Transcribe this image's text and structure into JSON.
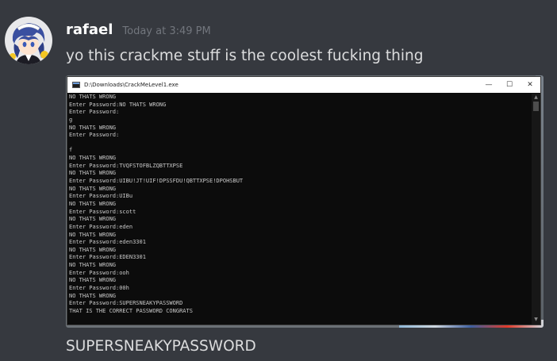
{
  "message": {
    "username": "rafael",
    "timestamp": "Today at 3:49 PM",
    "text": "yo this crackme stuff is the coolest fucking thing",
    "followup": "SUPERSNEAKYPASSWORD"
  },
  "console": {
    "title": "D:\\Downloads\\CrackMeLevel1.exe",
    "controls": {
      "minimize": "—",
      "maximize": "☐",
      "close": "✕"
    },
    "lines": [
      "NO THATS WRONG",
      "Enter Password:NO THATS WRONG",
      "Enter Password:",
      "g",
      "NO THATS WRONG",
      "Enter Password:",
      "",
      "f",
      "NO THATS WRONG",
      "Enter Password:TVQFSTOFBLZQBTTXPSE",
      "NO THATS WRONG",
      "Enter Password:UIBU!JT!UIF!DPSSFDU!QBTTXPSE!DPOHSBUT",
      "NO THATS WRONG",
      "Enter Password:UIBu",
      "NO THATS WRONG",
      "Enter Password:scott",
      "NO THATS WRONG",
      "Enter Password:eden",
      "NO THATS WRONG",
      "Enter Password:eden3301",
      "NO THATS WRONG",
      "Enter Password:EDEN3301",
      "NO THATS WRONG",
      "Enter Password:ooh",
      "NO THATS WRONG",
      "Enter Password:00h",
      "NO THATS WRONG",
      "Enter Password:SUPERSNEAKYPASSWORD",
      "THAT IS THE CORRECT PASSWORD CONGRATS",
      "",
      "_"
    ]
  },
  "icons": {
    "avatar": "anime-avatar",
    "app": "console-app-icon",
    "scroll_up": "▲",
    "scroll_down": "▼"
  }
}
